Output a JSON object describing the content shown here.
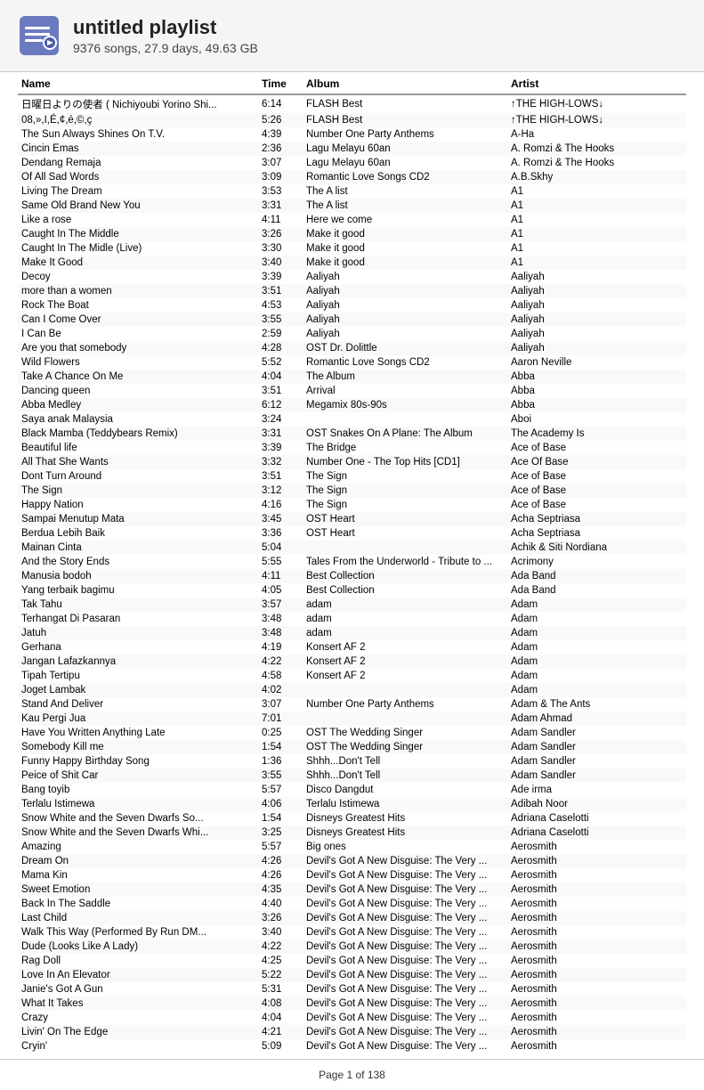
{
  "header": {
    "title": "untitled playlist",
    "subtitle": "9376 songs, 27.9 days, 49.63 GB"
  },
  "columns": {
    "name": "Name",
    "time": "Time",
    "album": "Album",
    "artist": "Artist"
  },
  "footer": "Page 1 of 138",
  "songs": [
    {
      "name": "日曜日よりの使者 ( Nichiyoubi Yorino Shi...",
      "time": "6:14",
      "album": "FLASH Best",
      "artist": "↑THE HIGH-LOWS↓"
    },
    {
      "name": "08,»,I,É,¢,é,©,ç",
      "time": "5:26",
      "album": "FLASH Best",
      "artist": "↑THE HIGH-LOWS↓"
    },
    {
      "name": "The Sun Always Shines On T.V.",
      "time": "4:39",
      "album": "Number One Party Anthems",
      "artist": "A-Ha"
    },
    {
      "name": "Cincin Emas",
      "time": "2:36",
      "album": "Lagu Melayu 60an",
      "artist": "A. Romzi & The Hooks"
    },
    {
      "name": "Dendang Remaja",
      "time": "3:07",
      "album": "Lagu Melayu 60an",
      "artist": "A. Romzi & The Hooks"
    },
    {
      "name": "Of All Sad Words",
      "time": "3:09",
      "album": "Romantic Love Songs CD2",
      "artist": "A.B.Skhy"
    },
    {
      "name": "Living The Dream",
      "time": "3:53",
      "album": "The A list",
      "artist": "A1"
    },
    {
      "name": "Same Old Brand New You",
      "time": "3:31",
      "album": "The A list",
      "artist": "A1"
    },
    {
      "name": "Like a rose",
      "time": "4:11",
      "album": "Here we come",
      "artist": "A1"
    },
    {
      "name": "Caught In The Middle",
      "time": "3:26",
      "album": "Make it good",
      "artist": "A1"
    },
    {
      "name": "Caught In The Midle (Live)",
      "time": "3:30",
      "album": "Make it good",
      "artist": "A1"
    },
    {
      "name": "Make It Good",
      "time": "3:40",
      "album": "Make it good",
      "artist": "A1"
    },
    {
      "name": "Decoy",
      "time": "3:39",
      "album": "Aaliyah",
      "artist": "Aaliyah"
    },
    {
      "name": "more than a women",
      "time": "3:51",
      "album": "Aaliyah",
      "artist": "Aaliyah"
    },
    {
      "name": "Rock The Boat",
      "time": "4:53",
      "album": "Aaliyah",
      "artist": "Aaliyah"
    },
    {
      "name": "Can I Come Over",
      "time": "3:55",
      "album": "Aaliyah",
      "artist": "Aaliyah"
    },
    {
      "name": "I Can Be",
      "time": "2:59",
      "album": "Aaliyah",
      "artist": "Aaliyah"
    },
    {
      "name": "Are you that somebody",
      "time": "4:28",
      "album": "OST Dr. Dolittle",
      "artist": "Aaliyah"
    },
    {
      "name": "Wild Flowers",
      "time": "5:52",
      "album": "Romantic Love Songs CD2",
      "artist": "Aaron Neville"
    },
    {
      "name": "Take A Chance On Me",
      "time": "4:04",
      "album": "The Album",
      "artist": "Abba"
    },
    {
      "name": "Dancing queen",
      "time": "3:51",
      "album": "Arrival",
      "artist": "Abba"
    },
    {
      "name": "Abba Medley",
      "time": "6:12",
      "album": "Megamix 80s-90s",
      "artist": "Abba"
    },
    {
      "name": "Saya anak Malaysia",
      "time": "3:24",
      "album": "",
      "artist": "Aboi"
    },
    {
      "name": "Black Mamba (Teddybears Remix)",
      "time": "3:31",
      "album": "OST Snakes On A Plane: The Album",
      "artist": "The Academy Is"
    },
    {
      "name": "Beautiful life",
      "time": "3:39",
      "album": "The Bridge",
      "artist": "Ace of Base"
    },
    {
      "name": "All That She Wants",
      "time": "3:32",
      "album": "Number One - The Top Hits [CD1]",
      "artist": "Ace Of Base"
    },
    {
      "name": "Dont Turn Around",
      "time": "3:51",
      "album": "The Sign",
      "artist": "Ace of Base"
    },
    {
      "name": "The Sign",
      "time": "3:12",
      "album": "The Sign",
      "artist": "Ace of Base"
    },
    {
      "name": "Happy Nation",
      "time": "4:16",
      "album": "The Sign",
      "artist": "Ace of Base"
    },
    {
      "name": "Sampai Menutup Mata",
      "time": "3:45",
      "album": "OST Heart",
      "artist": "Acha Septriasa"
    },
    {
      "name": "Berdua Lebih Baik",
      "time": "3:36",
      "album": "OST Heart",
      "artist": "Acha Septriasa"
    },
    {
      "name": "Mainan Cinta",
      "time": "5:04",
      "album": "",
      "artist": "Achik & Siti Nordiana"
    },
    {
      "name": "And the Story Ends",
      "time": "5:55",
      "album": "Tales From the Underworld - Tribute to ...",
      "artist": "Acrimony"
    },
    {
      "name": "Manusia bodoh",
      "time": "4:11",
      "album": "Best Collection",
      "artist": "Ada Band"
    },
    {
      "name": "Yang terbaik bagimu",
      "time": "4:05",
      "album": "Best Collection",
      "artist": "Ada Band"
    },
    {
      "name": "Tak Tahu",
      "time": "3:57",
      "album": "adam",
      "artist": "Adam"
    },
    {
      "name": "Terhangat Di Pasaran",
      "time": "3:48",
      "album": "adam",
      "artist": "Adam"
    },
    {
      "name": "Jatuh",
      "time": "3:48",
      "album": "adam",
      "artist": "Adam"
    },
    {
      "name": "Gerhana",
      "time": "4:19",
      "album": "Konsert AF 2",
      "artist": "Adam"
    },
    {
      "name": "Jangan Lafazkannya",
      "time": "4:22",
      "album": "Konsert AF 2",
      "artist": "Adam"
    },
    {
      "name": "Tipah Tertipu",
      "time": "4:58",
      "album": "Konsert AF 2",
      "artist": "Adam"
    },
    {
      "name": "Joget Lambak",
      "time": "4:02",
      "album": "",
      "artist": "Adam"
    },
    {
      "name": "Stand And Deliver",
      "time": "3:07",
      "album": "Number One Party Anthems",
      "artist": "Adam & The Ants"
    },
    {
      "name": "Kau Pergi Jua",
      "time": "7:01",
      "album": "",
      "artist": "Adam Ahmad"
    },
    {
      "name": "Have You Written Anything Late",
      "time": "0:25",
      "album": "OST The Wedding Singer",
      "artist": "Adam Sandler"
    },
    {
      "name": "Somebody Kill me",
      "time": "1:54",
      "album": "OST The Wedding Singer",
      "artist": "Adam Sandler"
    },
    {
      "name": "Funny Happy Birthday Song",
      "time": "1:36",
      "album": "Shhh...Don't Tell",
      "artist": "Adam Sandler"
    },
    {
      "name": "Peice of Shit Car",
      "time": "3:55",
      "album": "Shhh...Don't Tell",
      "artist": "Adam Sandler"
    },
    {
      "name": "Bang toyib",
      "time": "5:57",
      "album": "Disco Dangdut",
      "artist": "Ade irma"
    },
    {
      "name": "Terlalu Istimewa",
      "time": "4:06",
      "album": "Terlalu Istimewa",
      "artist": "Adibah Noor"
    },
    {
      "name": "Snow White and the Seven Dwarfs So...",
      "time": "1:54",
      "album": "Disneys Greatest Hits",
      "artist": "Adriana Caselotti"
    },
    {
      "name": "Snow White and the Seven Dwarfs Whi...",
      "time": "3:25",
      "album": "Disneys Greatest Hits",
      "artist": "Adriana Caselotti"
    },
    {
      "name": "Amazing",
      "time": "5:57",
      "album": "Big ones",
      "artist": "Aerosmith"
    },
    {
      "name": "Dream On",
      "time": "4:26",
      "album": "Devil's Got A New Disguise: The Very ...",
      "artist": "Aerosmith"
    },
    {
      "name": "Mama Kin",
      "time": "4:26",
      "album": "Devil's Got A New Disguise: The Very ...",
      "artist": "Aerosmith"
    },
    {
      "name": "Sweet Emotion",
      "time": "4:35",
      "album": "Devil's Got A New Disguise: The Very ...",
      "artist": "Aerosmith"
    },
    {
      "name": "Back In The Saddle",
      "time": "4:40",
      "album": "Devil's Got A New Disguise: The Very ...",
      "artist": "Aerosmith"
    },
    {
      "name": "Last Child",
      "time": "3:26",
      "album": "Devil's Got A New Disguise: The Very ...",
      "artist": "Aerosmith"
    },
    {
      "name": "Walk This Way (Performed By Run DM...",
      "time": "3:40",
      "album": "Devil's Got A New Disguise: The Very ...",
      "artist": "Aerosmith"
    },
    {
      "name": "Dude (Looks Like A Lady)",
      "time": "4:22",
      "album": "Devil's Got A New Disguise: The Very ...",
      "artist": "Aerosmith"
    },
    {
      "name": "Rag Doll",
      "time": "4:25",
      "album": "Devil's Got A New Disguise: The Very ...",
      "artist": "Aerosmith"
    },
    {
      "name": "Love In An Elevator",
      "time": "5:22",
      "album": "Devil's Got A New Disguise: The Very ...",
      "artist": "Aerosmith"
    },
    {
      "name": "Janie's Got A Gun",
      "time": "5:31",
      "album": "Devil's Got A New Disguise: The Very ...",
      "artist": "Aerosmith"
    },
    {
      "name": "What It Takes",
      "time": "4:08",
      "album": "Devil's Got A New Disguise: The Very ...",
      "artist": "Aerosmith"
    },
    {
      "name": "Crazy",
      "time": "4:04",
      "album": "Devil's Got A New Disguise: The Very ...",
      "artist": "Aerosmith"
    },
    {
      "name": "Livin' On The Edge",
      "time": "4:21",
      "album": "Devil's Got A New Disguise: The Very ...",
      "artist": "Aerosmith"
    },
    {
      "name": "Cryin'",
      "time": "5:09",
      "album": "Devil's Got A New Disguise: The Very ...",
      "artist": "Aerosmith"
    }
  ]
}
